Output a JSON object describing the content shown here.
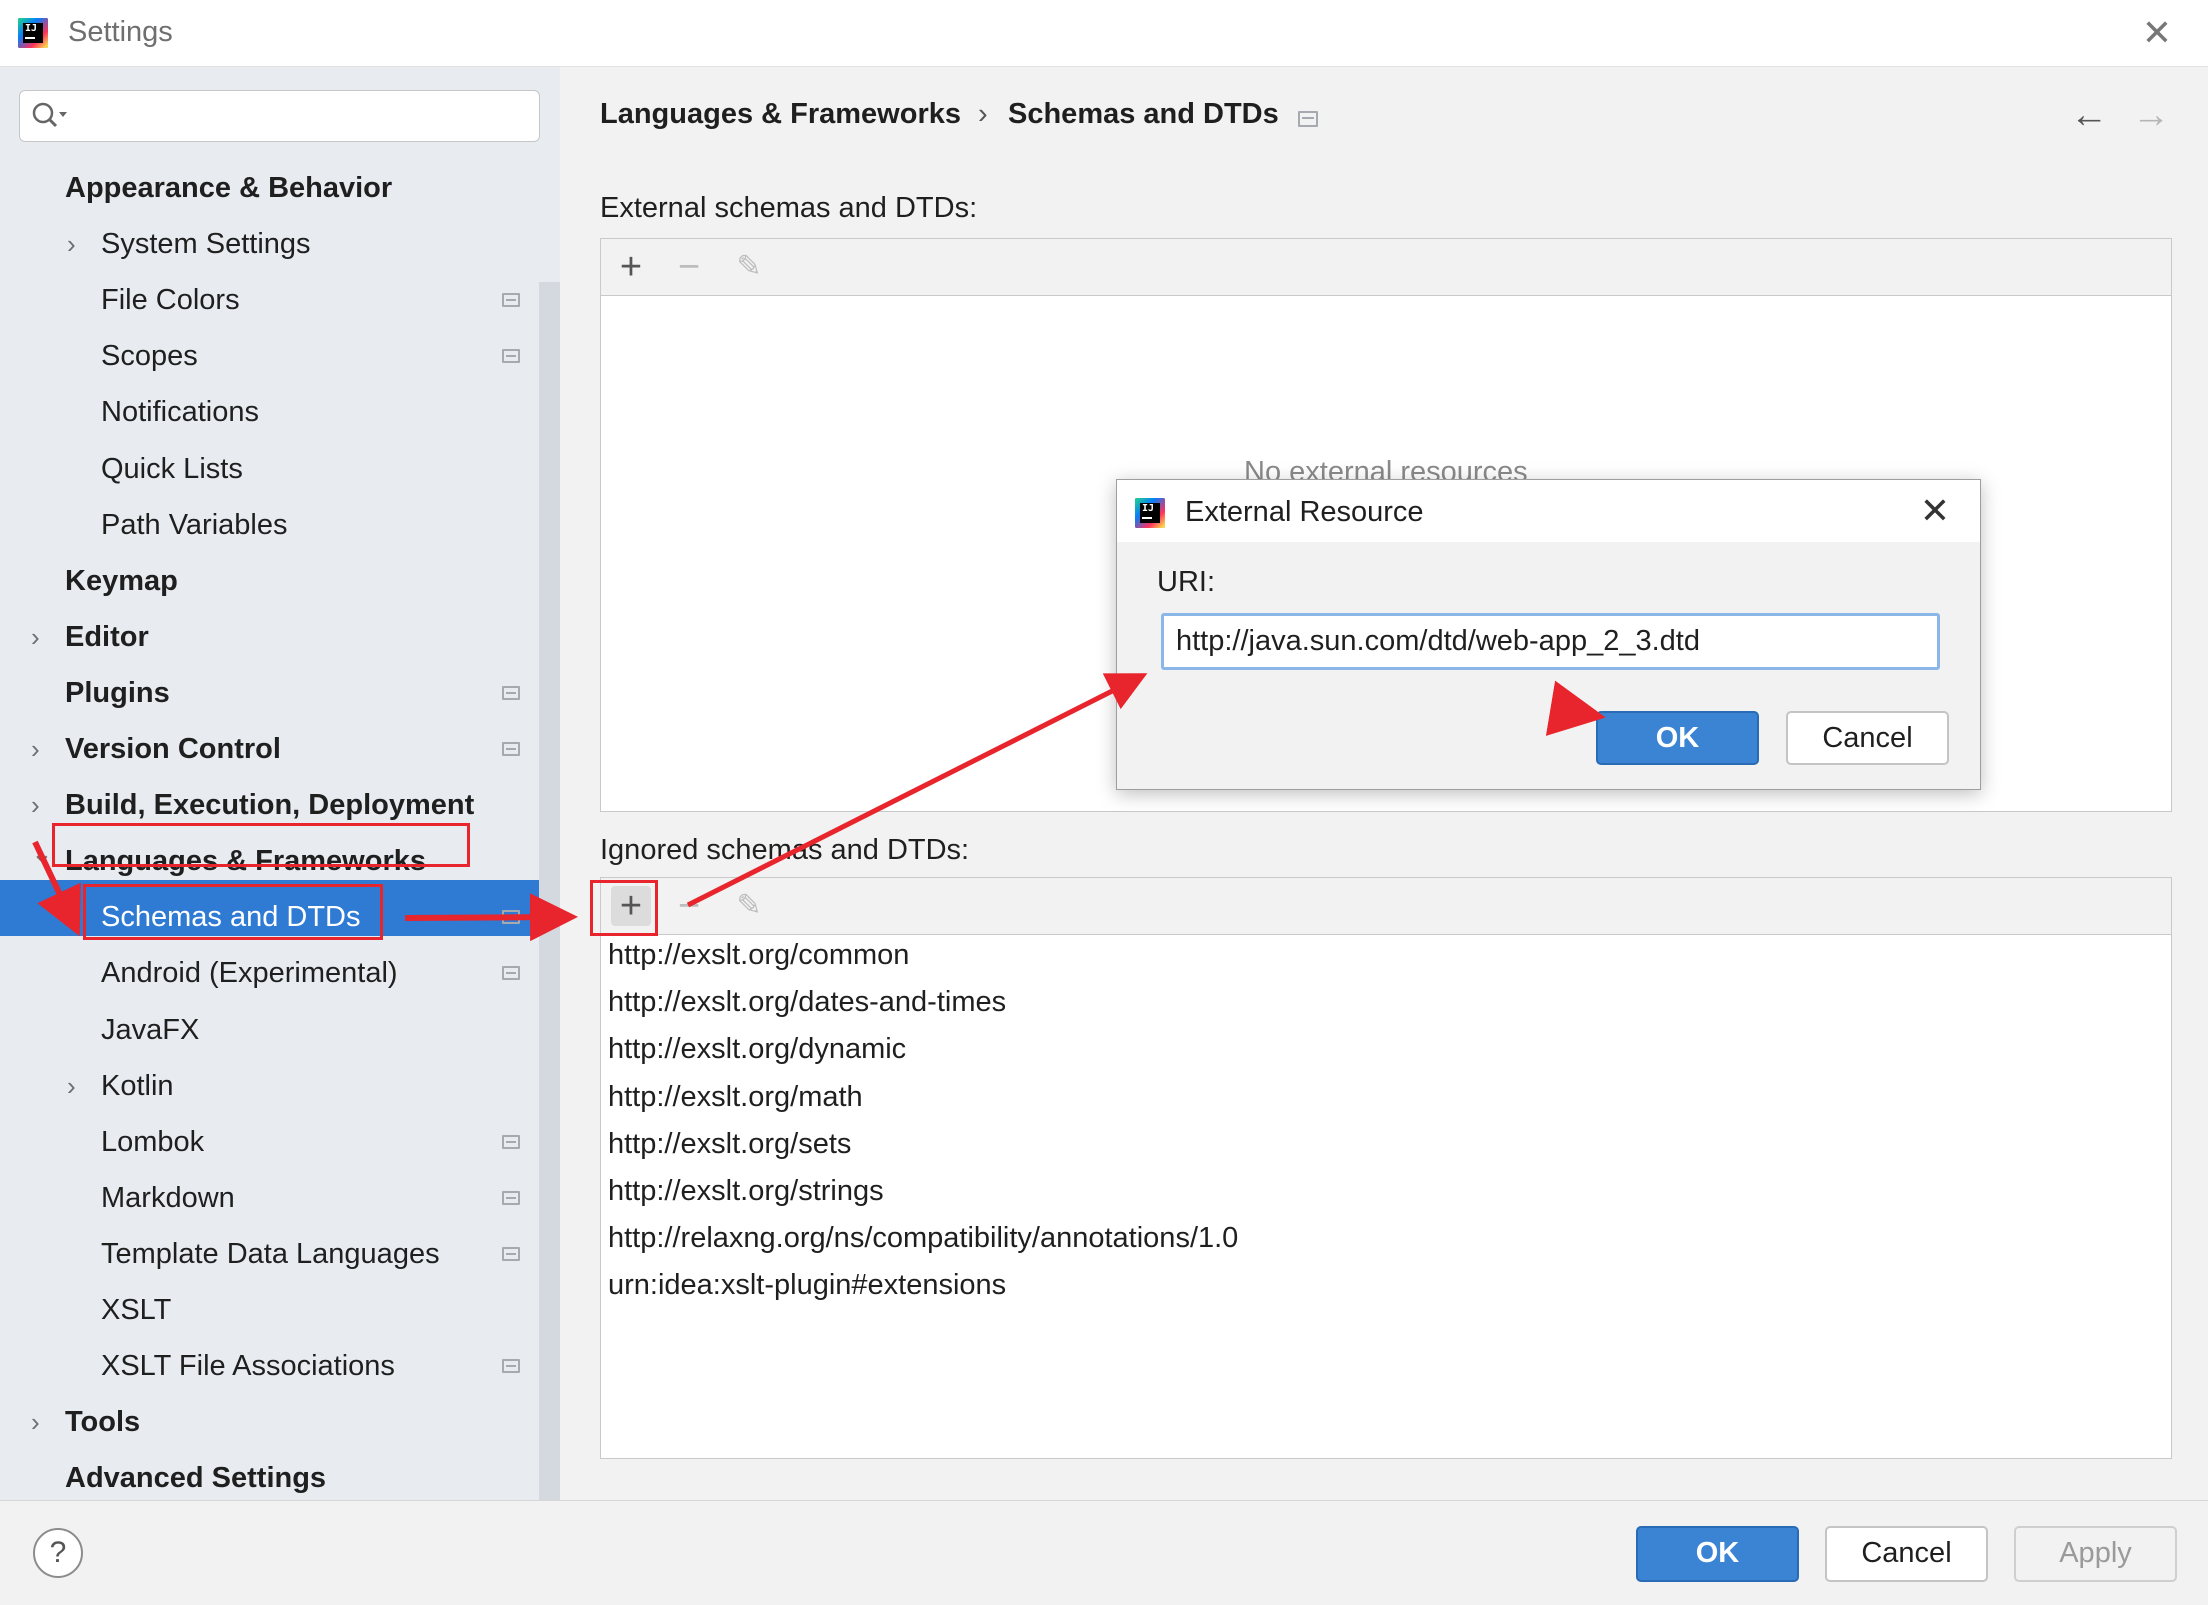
{
  "window": {
    "title": "Settings"
  },
  "search": {
    "placeholder": "",
    "value": ""
  },
  "sidebar": {
    "items": [
      {
        "label": "Appearance & Behavior",
        "bold": true,
        "indent": 0,
        "chevron": "none",
        "page_icon": false
      },
      {
        "label": "System Settings",
        "bold": false,
        "indent": 1,
        "chevron": "right",
        "page_icon": false
      },
      {
        "label": "File Colors",
        "bold": false,
        "indent": 1,
        "chevron": "none",
        "page_icon": true
      },
      {
        "label": "Scopes",
        "bold": false,
        "indent": 1,
        "chevron": "none",
        "page_icon": true
      },
      {
        "label": "Notifications",
        "bold": false,
        "indent": 1,
        "chevron": "none",
        "page_icon": false
      },
      {
        "label": "Quick Lists",
        "bold": false,
        "indent": 1,
        "chevron": "none",
        "page_icon": false
      },
      {
        "label": "Path Variables",
        "bold": false,
        "indent": 1,
        "chevron": "none",
        "page_icon": false
      },
      {
        "label": "Keymap",
        "bold": true,
        "indent": 0,
        "chevron": "none",
        "page_icon": false
      },
      {
        "label": "Editor",
        "bold": true,
        "indent": 0,
        "chevron": "right",
        "page_icon": false
      },
      {
        "label": "Plugins",
        "bold": true,
        "indent": 0,
        "chevron": "none",
        "page_icon": true
      },
      {
        "label": "Version Control",
        "bold": true,
        "indent": 0,
        "chevron": "right",
        "page_icon": true
      },
      {
        "label": "Build, Execution, Deployment",
        "bold": true,
        "indent": 0,
        "chevron": "right",
        "page_icon": false
      },
      {
        "label": "Languages & Frameworks",
        "bold": true,
        "indent": 0,
        "chevron": "down",
        "page_icon": false
      },
      {
        "label": "Schemas and DTDs",
        "bold": false,
        "indent": 1,
        "chevron": "right",
        "page_icon": true,
        "selected": true
      },
      {
        "label": "Android (Experimental)",
        "bold": false,
        "indent": 1,
        "chevron": "none",
        "page_icon": true
      },
      {
        "label": "JavaFX",
        "bold": false,
        "indent": 1,
        "chevron": "none",
        "page_icon": false
      },
      {
        "label": "Kotlin",
        "bold": false,
        "indent": 1,
        "chevron": "right",
        "page_icon": false
      },
      {
        "label": "Lombok",
        "bold": false,
        "indent": 1,
        "chevron": "none",
        "page_icon": true
      },
      {
        "label": "Markdown",
        "bold": false,
        "indent": 1,
        "chevron": "none",
        "page_icon": true
      },
      {
        "label": "Template Data Languages",
        "bold": false,
        "indent": 1,
        "chevron": "none",
        "page_icon": true
      },
      {
        "label": "XSLT",
        "bold": false,
        "indent": 1,
        "chevron": "none",
        "page_icon": false
      },
      {
        "label": "XSLT File Associations",
        "bold": false,
        "indent": 1,
        "chevron": "none",
        "page_icon": true
      },
      {
        "label": "Tools",
        "bold": true,
        "indent": 0,
        "chevron": "right",
        "page_icon": false
      },
      {
        "label": "Advanced Settings",
        "bold": true,
        "indent": 0,
        "chevron": "none",
        "page_icon": false
      }
    ]
  },
  "breadcrumb": {
    "parent": "Languages & Frameworks",
    "separator": "›",
    "current": "Schemas and DTDs"
  },
  "external": {
    "label": "External schemas and DTDs:",
    "empty_text": "No external resources"
  },
  "ignored": {
    "label": "Ignored schemas and DTDs:",
    "rows": [
      "http://exslt.org/common",
      "http://exslt.org/dates-and-times",
      "http://exslt.org/dynamic",
      "http://exslt.org/math",
      "http://exslt.org/sets",
      "http://exslt.org/strings",
      "http://relaxng.org/ns/compatibility/annotations/1.0",
      "urn:idea:xslt-plugin#extensions"
    ]
  },
  "dialog": {
    "title": "External Resource",
    "uri_label": "URI:",
    "uri_value": "http://java.sun.com/dtd/web-app_2_3.dtd",
    "ok_label": "OK",
    "cancel_label": "Cancel"
  },
  "footer": {
    "help": "?",
    "ok_label": "OK",
    "cancel_label": "Cancel",
    "apply_label": "Apply"
  },
  "icons": {
    "toolbar": [
      "add-icon",
      "remove-icon",
      "edit-icon"
    ],
    "nav": [
      "back-arrow-icon",
      "forward-arrow-icon"
    ]
  },
  "colors": {
    "accent": "#2f7bd4",
    "primary_button": "#3b84d4",
    "annotation": "#e8242c"
  }
}
